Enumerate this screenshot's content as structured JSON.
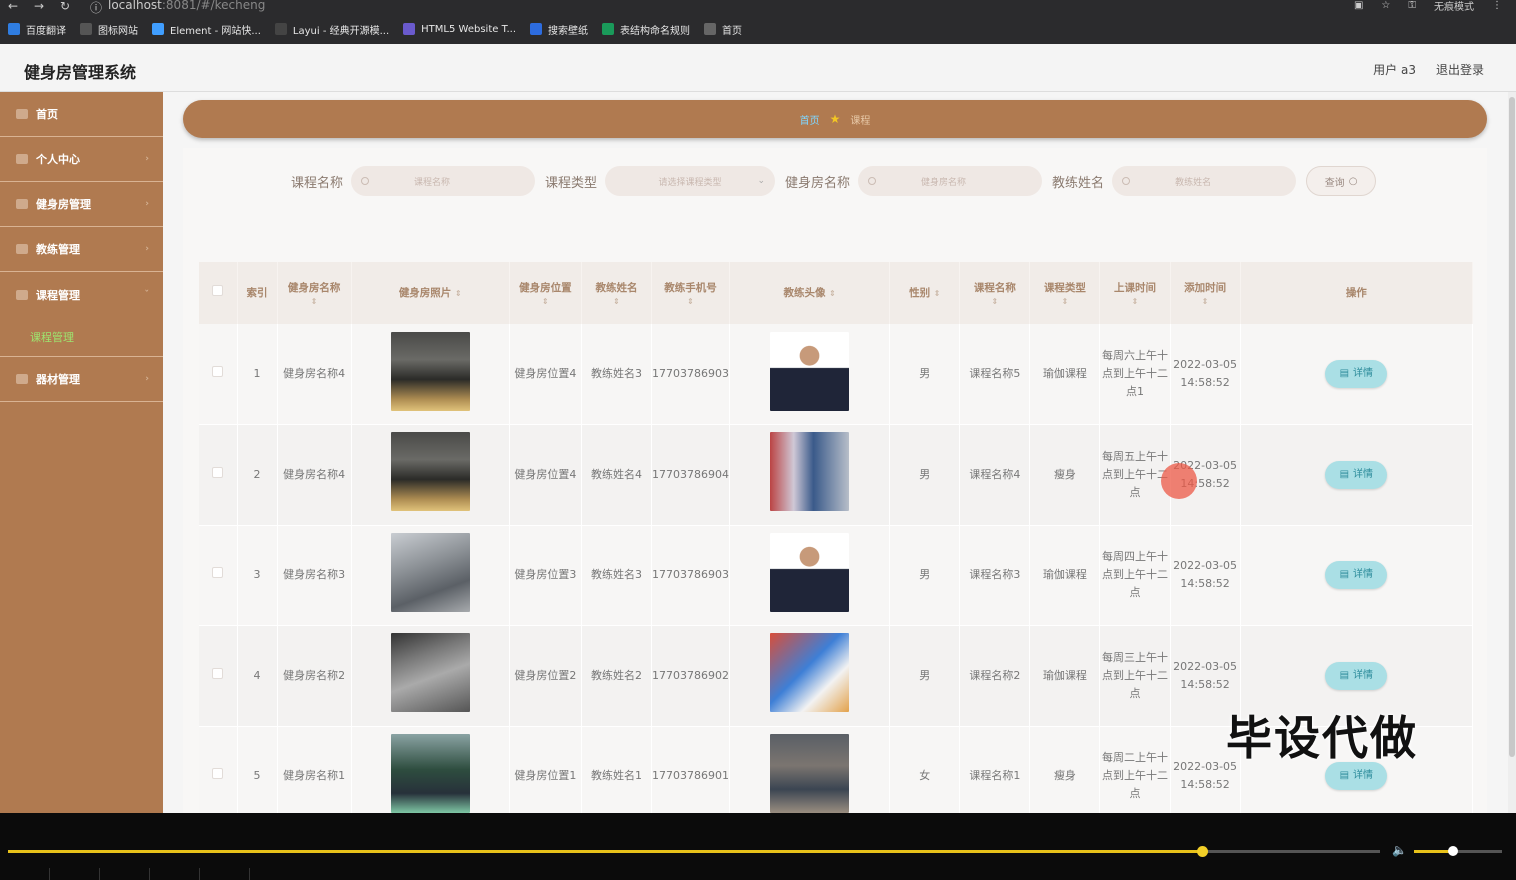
{
  "browser": {
    "url_host": "localhost",
    "url_rest": ":8081/#/kecheng",
    "incognito_label": "无痕模式",
    "bookmarks": [
      {
        "icon": "translate-icon",
        "label": "百度翻译",
        "color": "#2f7de1"
      },
      {
        "icon": "folder-icon",
        "label": "图标网站",
        "color": "#555"
      },
      {
        "icon": "element-icon",
        "label": "Element - 网站快...",
        "color": "#409eff"
      },
      {
        "icon": "layui-icon",
        "label": "Layui - 经典开源模...",
        "color": "#444"
      },
      {
        "icon": "html5-icon",
        "label": "HTML5 Website T...",
        "color": "#6a5acd"
      },
      {
        "icon": "wallpaper-icon",
        "label": "搜索壁纸",
        "color": "#2d6cdf"
      },
      {
        "icon": "naming-icon",
        "label": "表结构命名规则",
        "color": "#1a9a5a"
      },
      {
        "icon": "globe-icon",
        "label": "首页",
        "color": "#666"
      }
    ]
  },
  "header": {
    "title": "健身房管理系统",
    "user": "用户 a3",
    "logout": "退出登录"
  },
  "sidebar": {
    "items": [
      {
        "label": "首页",
        "arrow": false
      },
      {
        "label": "个人中心",
        "arrow": true
      },
      {
        "label": "健身房管理",
        "arrow": true
      },
      {
        "label": "教练管理",
        "arrow": true
      },
      {
        "label": "课程管理",
        "arrow": true
      }
    ],
    "active_sub": "课程管理",
    "last_item": "器材管理"
  },
  "breadcrumb": {
    "home": "首页",
    "current": "课程"
  },
  "search": {
    "fields": [
      {
        "label": "课程名称",
        "placeholder": "课程名称"
      },
      {
        "label": "课程类型",
        "placeholder": "请选择课程类型"
      },
      {
        "label": "健身房名称",
        "placeholder": "健身房名称"
      },
      {
        "label": "教练姓名",
        "placeholder": "教练姓名"
      }
    ],
    "button": "查询"
  },
  "table": {
    "headers": [
      "索引",
      "健身房名称",
      "健身房照片",
      "健身房位置",
      "教练姓名",
      "教练手机号",
      "教练头像",
      "性别",
      "课程名称",
      "课程类型",
      "上课时间",
      "添加时间",
      "操作"
    ],
    "detail_label": "详情",
    "rows": [
      {
        "index": "1",
        "gym": "健身房名称4",
        "gym_photo": "gym1",
        "location": "健身房位置4",
        "coach": "教练姓名3",
        "phone": "17703786903",
        "avatar": "coach1",
        "gender": "男",
        "course": "课程名称5",
        "type": "瑜伽课程",
        "time": "每周六上午十点到上午十二点1",
        "added": "2022-03-05 14:58:52"
      },
      {
        "index": "2",
        "gym": "健身房名称4",
        "gym_photo": "gym1",
        "location": "健身房位置4",
        "coach": "教练姓名4",
        "phone": "17703786904",
        "avatar": "coach2",
        "gender": "男",
        "course": "课程名称4",
        "type": "瘦身",
        "time": "每周五上午十点到上午十二点",
        "added": "2022-03-05 14:58:52"
      },
      {
        "index": "3",
        "gym": "健身房名称3",
        "gym_photo": "gym2",
        "location": "健身房位置3",
        "coach": "教练姓名3",
        "phone": "17703786903",
        "avatar": "coach1",
        "gender": "男",
        "course": "课程名称3",
        "type": "瑜伽课程",
        "time": "每周四上午十点到上午十二点",
        "added": "2022-03-05 14:58:52"
      },
      {
        "index": "4",
        "gym": "健身房名称2",
        "gym_photo": "gym3",
        "location": "健身房位置2",
        "coach": "教练姓名2",
        "phone": "17703786902",
        "avatar": "coach3",
        "gender": "男",
        "course": "课程名称2",
        "type": "瑜伽课程",
        "time": "每周三上午十点到上午十二点",
        "added": "2022-03-05 14:58:52"
      },
      {
        "index": "5",
        "gym": "健身房名称1",
        "gym_photo": "gym4",
        "location": "健身房位置1",
        "coach": "教练姓名1",
        "phone": "17703786901",
        "avatar": "coach4",
        "gender": "女",
        "course": "课程名称1",
        "type": "瘦身",
        "time": "每周二上午十点到上午十二点",
        "added": "2022-03-05 14:58:52"
      }
    ]
  },
  "watermark": "毕设代做",
  "player": {
    "progress": 0.87,
    "volume": 0.5
  }
}
